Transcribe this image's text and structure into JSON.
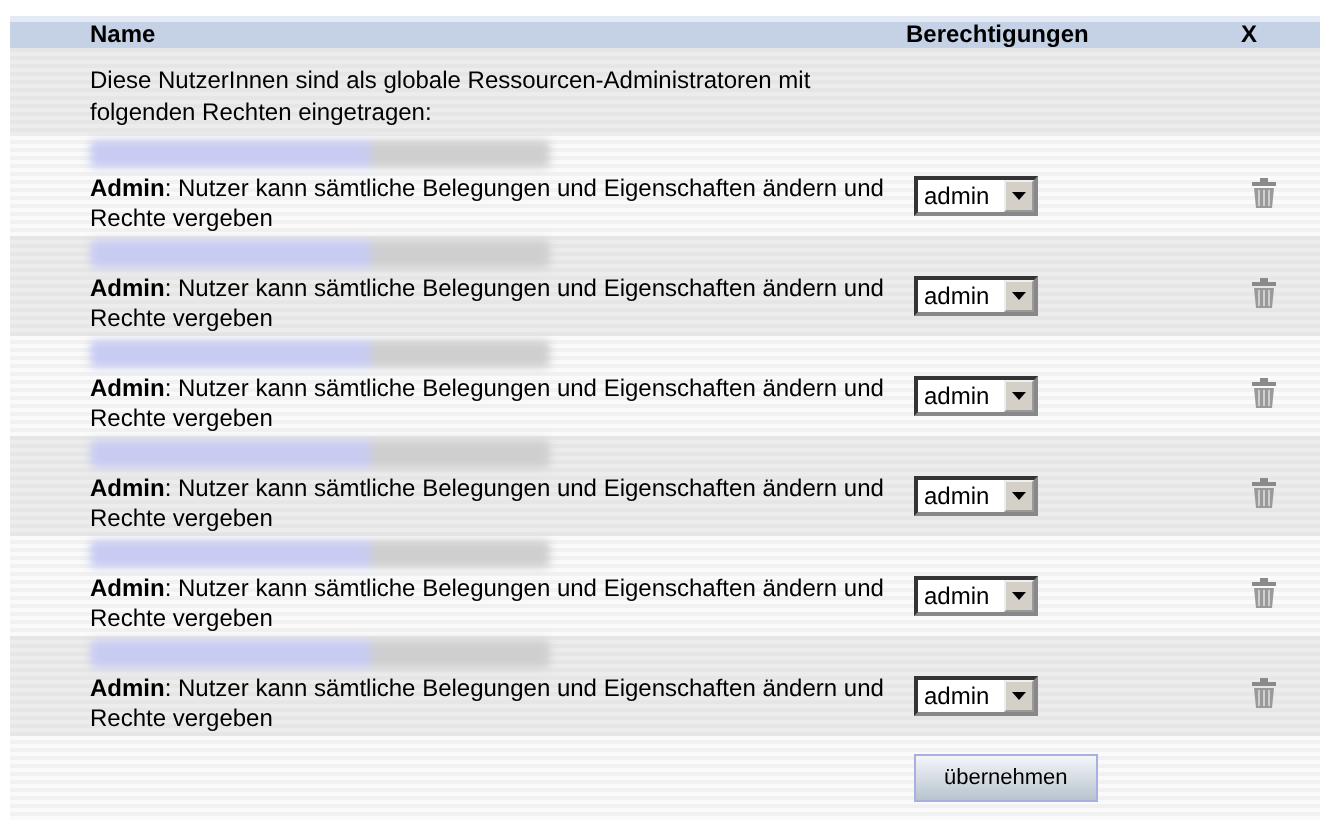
{
  "table": {
    "columns": [
      "Name",
      "Berechtigungen",
      "X"
    ],
    "intro": "Diese NutzerInnen sind als globale Ressourcen-Administratoren mit folgenden Rechten eingetragen:",
    "rows": [
      {
        "name_redacted": true,
        "description": "**Admin**: Nutzer kann sämtliche Belegungen und Eigenschaften ändern und Rechte vergeben",
        "role": "admin"
      },
      {
        "name_redacted": true,
        "description": "**Admin**: Nutzer kann sämtliche Belegungen und Eigenschaften ändern und Rechte vergeben",
        "role": "admin"
      },
      {
        "name_redacted": true,
        "description": "**Admin**: Nutzer kann sämtliche Belegungen und Eigenschaften ändern und Rechte vergeben",
        "role": "admin"
      },
      {
        "name_redacted": true,
        "description": "**Admin**: Nutzer kann sämtliche Belegungen und Eigenschaften ändern und Rechte vergeben",
        "role": "admin"
      },
      {
        "name_redacted": true,
        "description": "**Admin**: Nutzer kann sämtliche Belegungen und Eigenschaften ändern und Rechte vergeben",
        "role": "admin"
      },
      {
        "name_redacted": true,
        "description": "**Admin**: Nutzer kann sämtliche Belegungen und Eigenschaften ändern und Rechte vergeben",
        "role": "admin"
      }
    ]
  },
  "submit_button": "übernehmen"
}
